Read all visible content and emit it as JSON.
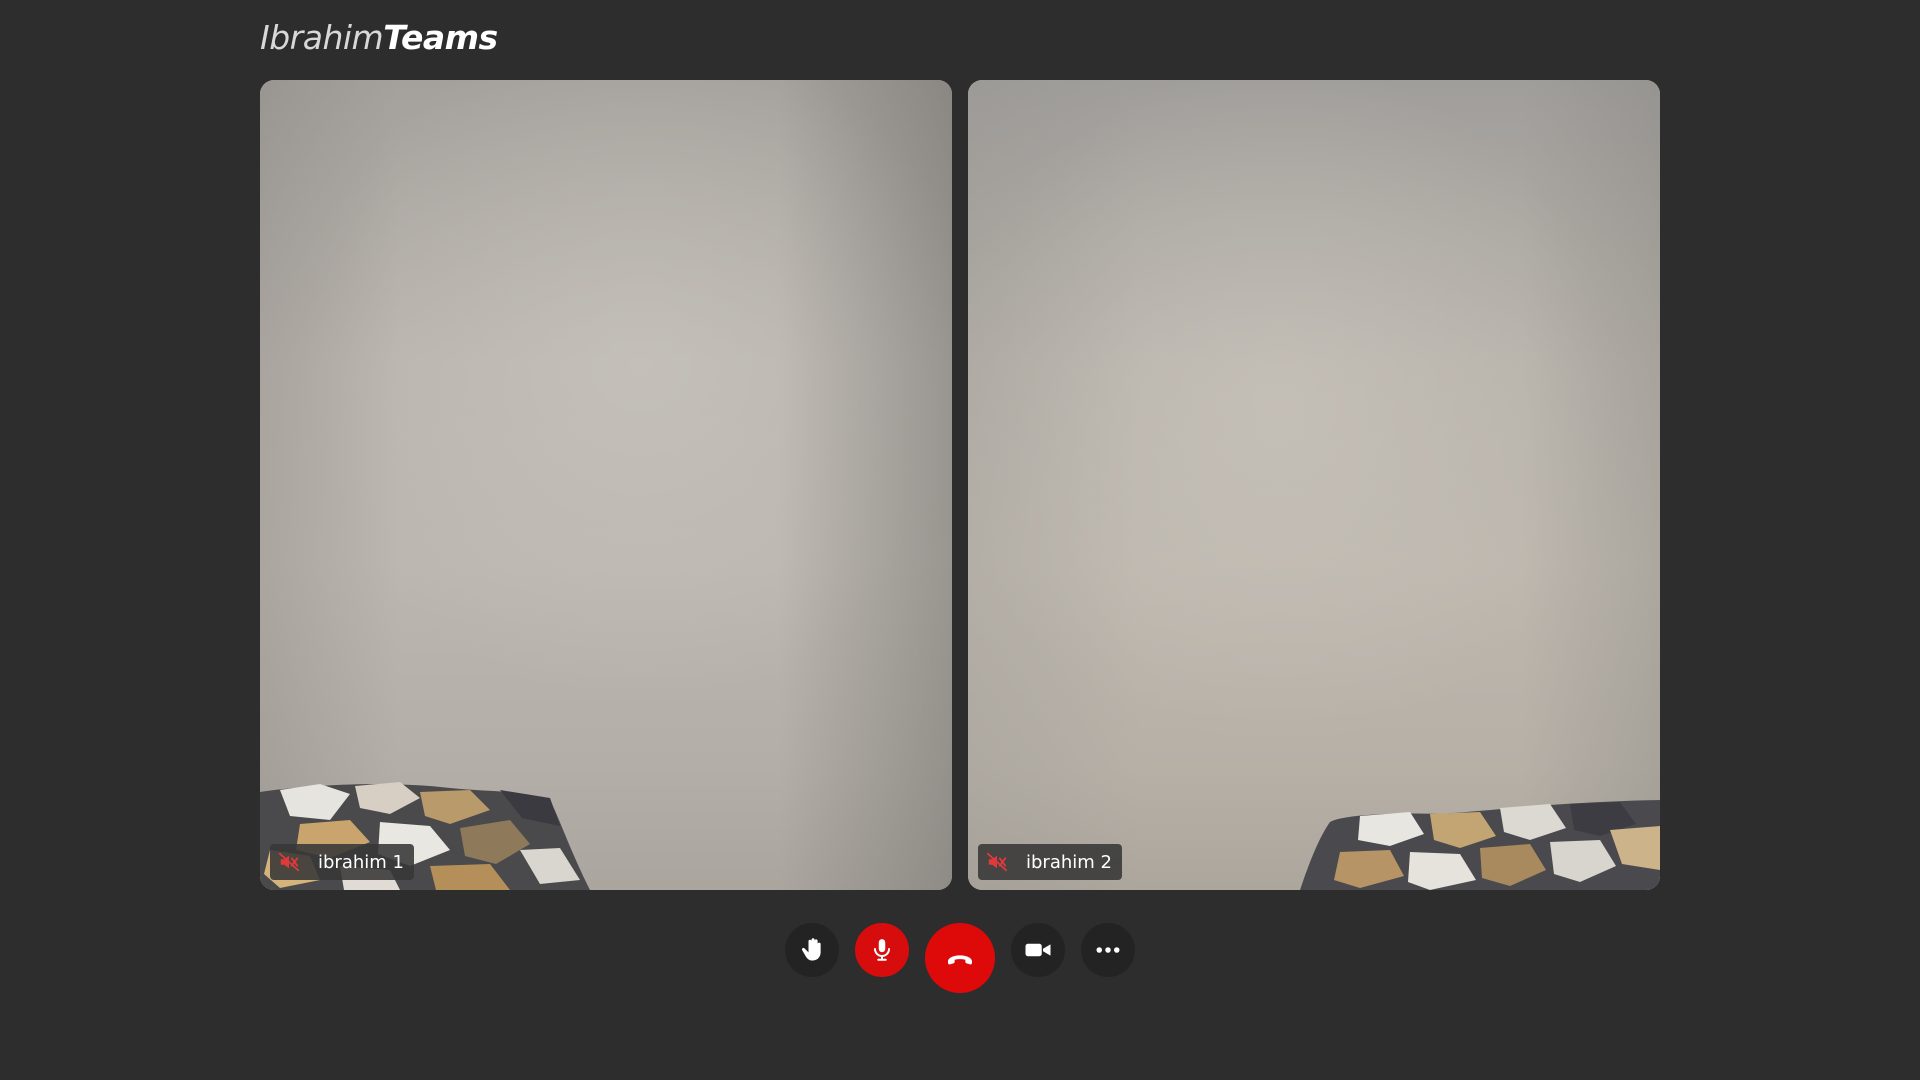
{
  "app": {
    "logo_light": "Ibrahim",
    "logo_bold": "Teams"
  },
  "participants": [
    {
      "name": "ibrahim 1",
      "muted": true
    },
    {
      "name": "ibrahim 2",
      "muted": true
    }
  ],
  "controls": [
    {
      "icon": "raise-hand-icon"
    },
    {
      "icon": "microphone-icon"
    },
    {
      "icon": "hang-up-icon"
    },
    {
      "icon": "video-camera-icon"
    },
    {
      "icon": "more-options-icon"
    }
  ],
  "colors": {
    "background": "#2d2d2d",
    "accent_red": "#de0a0a",
    "button_dark": "#232323",
    "muted_icon": "#e0393b"
  }
}
